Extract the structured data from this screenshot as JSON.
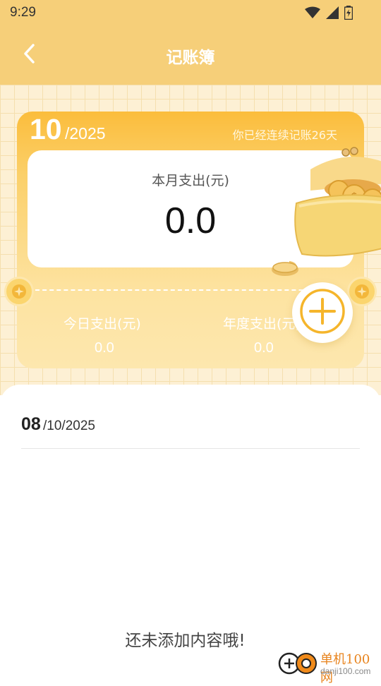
{
  "status_bar": {
    "time": "9:29"
  },
  "header": {
    "title": "记账簿",
    "back_icon": "chevron-left-icon"
  },
  "summary": {
    "month": "10",
    "year_suffix": "/2025",
    "streak_text": "你已经连续记账26天",
    "month_label": "本月支出(元)",
    "month_value": "0.0",
    "today_label": "今日支出(元)",
    "today_value": "0.0",
    "year_label": "年度支出(元)",
    "year_value": "0.0"
  },
  "add_button": {
    "icon": "plus-icon"
  },
  "list": {
    "date_day": "08",
    "date_rest": "/10/2025",
    "empty_text": "还未添加内容哦!"
  },
  "watermark": {
    "title": "单机100网",
    "url": "danji100.com"
  },
  "colors": {
    "header_bg": "#f6cf79",
    "card_top": "#fbbd3c",
    "accent": "#f5b52b",
    "grid_bg": "#fdf0d4"
  }
}
